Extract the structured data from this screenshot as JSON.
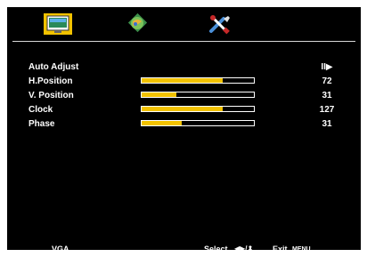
{
  "menu": {
    "tabs": [
      {
        "name": "picture",
        "icon": "monitor-icon",
        "selected": true
      },
      {
        "name": "color",
        "icon": "color-globe-icon",
        "selected": false
      },
      {
        "name": "setup",
        "icon": "tools-icon",
        "selected": false
      }
    ],
    "items": [
      {
        "label": "Auto Adjust",
        "value": "II▶",
        "level": null
      },
      {
        "label": "H.Position",
        "value": "72",
        "level": 0.72
      },
      {
        "label": "V. Position",
        "value": "31",
        "level": 0.31
      },
      {
        "label": "Clock",
        "value": "127",
        "level": 0.72
      },
      {
        "label": "Phase",
        "value": "31",
        "level": 0.36
      }
    ]
  },
  "footer": {
    "source": "VGA",
    "hint_select": "Select",
    "hint_arrows": "◀▶/⬍",
    "hint_exit": "Exit",
    "hint_menu": "MENU"
  },
  "colors": {
    "accent": "#f2c200",
    "background": "#000000",
    "text": "#ffffff"
  }
}
